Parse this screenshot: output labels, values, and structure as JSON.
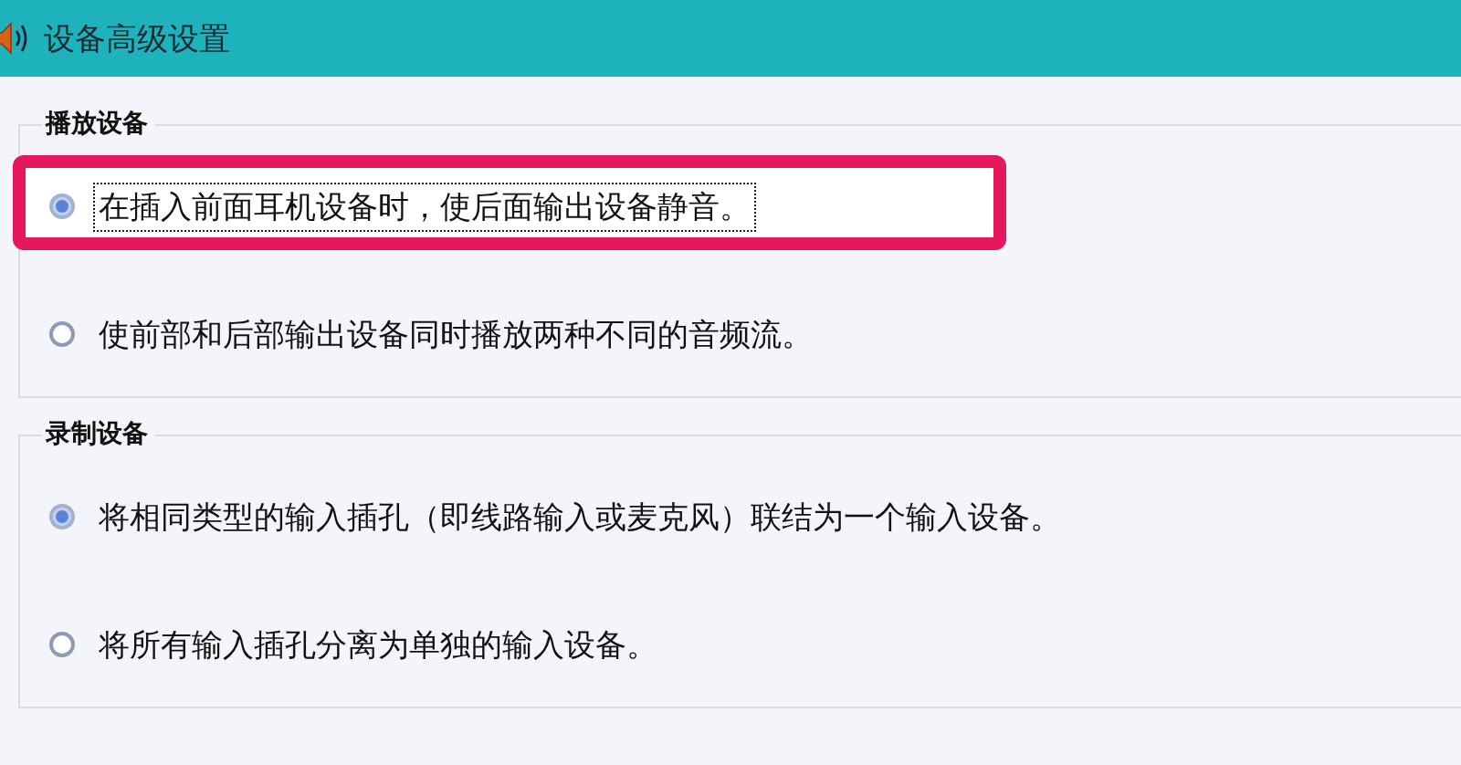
{
  "window": {
    "title": "设备高级设置"
  },
  "groups": [
    {
      "legend": "播放设备",
      "options": [
        {
          "label": "在插入前面耳机设备时，使后面输出设备静音。",
          "selected": true,
          "focused": true,
          "highlighted": true
        },
        {
          "label": "使前部和后部输出设备同时播放两种不同的音频流。",
          "selected": false,
          "focused": false,
          "highlighted": false
        }
      ]
    },
    {
      "legend": "录制设备",
      "options": [
        {
          "label": "将相同类型的输入插孔（即线路输入或麦克风）联结为一个输入设备。",
          "selected": true,
          "focused": false,
          "highlighted": false
        },
        {
          "label": "将所有输入插孔分离为单独的输入设备。",
          "selected": false,
          "focused": false,
          "highlighted": false
        }
      ]
    }
  ]
}
